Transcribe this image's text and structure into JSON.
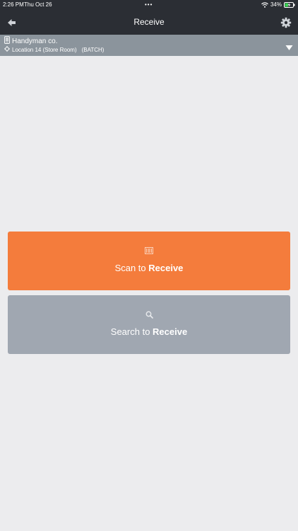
{
  "status_bar": {
    "time": "2:26 PM",
    "date": "Thu Oct 26",
    "dots": "•••",
    "battery": "34%",
    "icons": [
      "wifi-icon",
      "battery-charging-icon"
    ]
  },
  "nav": {
    "title": "Receive",
    "back_icon": "back-arrow-icon",
    "settings_icon": "gear-icon"
  },
  "context": {
    "company": "Handyman co.",
    "location": "Location 14 (Store Room)",
    "mode": "(BATCH)",
    "icons": [
      "device-icon",
      "location-pin-icon",
      "caret-down-icon"
    ]
  },
  "actions": {
    "scan": {
      "prefix": "Scan to ",
      "emphasis": "Receive",
      "icon": "barcode-icon",
      "color": "#f47c3c"
    },
    "search": {
      "prefix": "Search to ",
      "emphasis": "Receive",
      "icon": "search-icon",
      "color": "#a0a7b1"
    }
  },
  "colors": {
    "header": "#2b2e34",
    "context_bar": "#8b949c",
    "background": "#ececee"
  }
}
